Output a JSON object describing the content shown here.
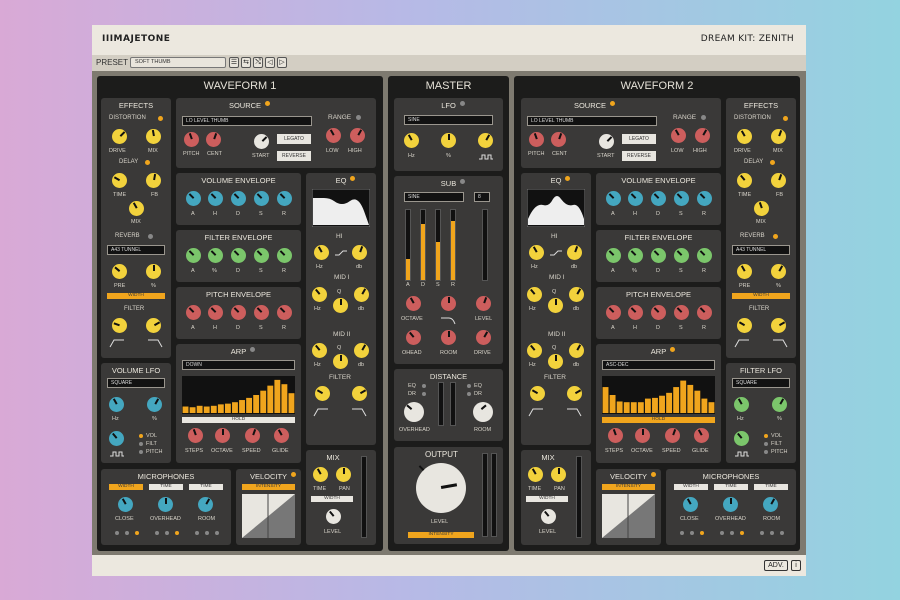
{
  "app": {
    "logo": "IIIMAJETONE",
    "title": "DREAM KIT: ZENITH"
  },
  "preset": {
    "label": "PRESET",
    "value": "SOFT THUMB",
    "buttons": [
      "☰",
      "⇆",
      "⤭",
      "◁",
      "▷"
    ]
  },
  "footer": {
    "adv": "ADV.",
    "info": "i"
  },
  "colors": {
    "accent": "#f0a51d",
    "knob_yellow": "#f2d23c",
    "knob_blue": "#44a7c0",
    "knob_green": "#7bc66b",
    "knob_red": "#cd5e5d",
    "panel": "#1c1c1b",
    "section": "#3a3938"
  },
  "w1": {
    "title": "WAVEFORM 1",
    "effects": {
      "title": "EFFECTS",
      "distortion": "DISTORTION",
      "drive": "DRIVE",
      "mix": "MIX",
      "delay": "DELAY",
      "time": "TIME",
      "fb": "FB",
      "mix2": "MIX",
      "reverb": "REVERB",
      "reverb_preset": "A43 TUNNEL",
      "pre": "PRE",
      "pct": "%",
      "width": "WIDTH",
      "filter": "FILTER"
    },
    "source": {
      "title": "SOURCE",
      "field": "LO LEVEL THUMB",
      "pitch": "PITCH",
      "cent": "CENT",
      "start": "START",
      "legato": "LEGATO",
      "reverse": "REVERSE",
      "range": "RANGE",
      "low": "LOW",
      "high": "HIGH"
    },
    "venv": {
      "title": "VOLUME ENVELOPE",
      "l": [
        "A",
        "H",
        "D",
        "S",
        "R"
      ]
    },
    "fenv": {
      "title": "FILTER ENVELOPE",
      "l": [
        "A",
        "%",
        "D",
        "S",
        "R"
      ]
    },
    "penv": {
      "title": "PITCH ENVELOPE",
      "l": [
        "A",
        "H",
        "D",
        "S",
        "R"
      ]
    },
    "eq": {
      "title": "EQ",
      "hi": "HI",
      "hz": "Hz",
      "db": "db",
      "mid1": "MID I",
      "q": "Q",
      "mid2": "MID II",
      "filter": "FILTER"
    },
    "lfo": {
      "title": "VOLUME LFO",
      "wave": "SQUARE",
      "hz": "Hz",
      "pct": "%",
      "vol": "VOL",
      "filt": "FILT",
      "pitch": "PITCH"
    },
    "arp": {
      "title": "ARP",
      "mode": "DOWN",
      "hold": "HOLD",
      "steps": "STEPS",
      "octave": "OCTAVE",
      "speed": "SPEED",
      "glide": "GLIDE",
      "bars": [
        0.18,
        0.16,
        0.2,
        0.18,
        0.2,
        0.24,
        0.26,
        0.3,
        0.36,
        0.42,
        0.5,
        0.62,
        0.76,
        0.92,
        0.8,
        0.55
      ]
    },
    "mic": {
      "title": "MICROPHONES",
      "width": "WIDTH",
      "time": "TIME",
      "time2": "TIME",
      "close": "CLOSE",
      "overhead": "OVERHEAD",
      "room": "ROOM"
    },
    "vel": {
      "title": "VELOCITY",
      "intensity": "INTENSITY"
    },
    "mix": {
      "title": "MIX",
      "time": "TIME",
      "pan": "PAN",
      "width": "WIDTH",
      "level": "LEVEL"
    }
  },
  "master": {
    "title": "MASTER",
    "lfo": {
      "title": "LFO",
      "wave": "SINE",
      "hz": "Hz",
      "pct": "%"
    },
    "sub": {
      "title": "SUB",
      "wave": "SINE",
      "num": "8",
      "adsr": [
        "A",
        "D",
        "S",
        "R"
      ],
      "levels": [
        0.3,
        0.8,
        0.55,
        0.85
      ],
      "octave": "OCTAVE",
      "level": "LEVEL",
      "ohead": "OHEAD",
      "room": "ROOM",
      "drive": "DRIVE"
    },
    "distance": {
      "title": "DISTANCE",
      "eq": "EQ",
      "dr": "DR",
      "overhead": "OVERHEAD",
      "room": "ROOM"
    },
    "output": {
      "title": "OUTPUT",
      "level": "LEVEL",
      "intensity": "INTENSITY"
    }
  },
  "w2": {
    "title": "WAVEFORM 2",
    "effects": {
      "title": "EFFECTS",
      "distortion": "DISTORTION",
      "drive": "DRIVE",
      "mix": "MIX",
      "delay": "DELAY",
      "time": "TIME",
      "fb": "FB",
      "mix2": "MIX",
      "reverb": "REVERB",
      "reverb_preset": "A43 TUNNEL",
      "pre": "PRE",
      "pct": "%",
      "width": "WIDTH",
      "filter": "FILTER"
    },
    "source": {
      "title": "SOURCE",
      "field": "LO LEVEL THUMB",
      "pitch": "PITCH",
      "cent": "CENT",
      "start": "START",
      "legato": "LEGATO",
      "reverse": "REVERSE",
      "range": "RANGE",
      "low": "LOW",
      "high": "HIGH"
    },
    "venv": {
      "title": "VOLUME ENVELOPE",
      "l": [
        "A",
        "H",
        "D",
        "S",
        "R"
      ]
    },
    "fenv": {
      "title": "FILTER ENVELOPE",
      "l": [
        "A",
        "%",
        "D",
        "S",
        "R"
      ]
    },
    "penv": {
      "title": "PITCH ENVELOPE",
      "l": [
        "A",
        "H",
        "D",
        "S",
        "R"
      ]
    },
    "eq": {
      "title": "EQ",
      "hi": "HI",
      "hz": "Hz",
      "db": "db",
      "mid1": "MID I",
      "q": "Q",
      "mid2": "MID II",
      "filter": "FILTER"
    },
    "lfo": {
      "title": "FILTER LFO",
      "wave": "SQUARE",
      "hz": "Hz",
      "pct": "%",
      "vol": "VOL",
      "filt": "FILT",
      "pitch": "PITCH"
    },
    "arp": {
      "title": "ARP",
      "mode": "ASC-DEC",
      "hold": "HOLD",
      "steps": "STEPS",
      "octave": "OCTAVE",
      "speed": "SPEED",
      "glide": "GLIDE",
      "bars": [
        0.72,
        0.5,
        0.32,
        0.3,
        0.3,
        0.3,
        0.4,
        0.42,
        0.48,
        0.56,
        0.72,
        0.9,
        0.78,
        0.62,
        0.4,
        0.3
      ]
    },
    "mic": {
      "title": "MICROPHONES",
      "width": "WIDTH",
      "time": "TIME",
      "time2": "TIME",
      "close": "CLOSE",
      "overhead": "OVERHEAD",
      "room": "ROOM"
    },
    "vel": {
      "title": "VELOCITY",
      "intensity": "INTENSITY"
    },
    "mix": {
      "title": "MIX",
      "time": "TIME",
      "pan": "PAN",
      "width": "WIDTH",
      "level": "LEVEL"
    }
  }
}
